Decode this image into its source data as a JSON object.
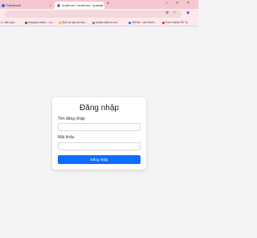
{
  "browser": {
    "tabs": [
      {
        "label": "Facebook",
        "favicon_color": "#1877f2"
      },
      {
        "label": "localhost / localhost / quanlyl",
        "favicon_color": "#6c78af"
      }
    ],
    "new_tab_symbol": "+",
    "window_controls": [
      "–",
      "□",
      "×"
    ],
    "tab_close_symbol": "×",
    "toolbar_icons": {
      "translate": "⊕",
      "star": "☆",
      "profile": "◉"
    },
    "bookmarks": [
      {
        "label": "c—Bài qua...",
        "color": "#999999"
      },
      {
        "label": "Notepad online - Le...",
        "color": "#2e7d32"
      },
      {
        "label": "Dịch vụ lấy mã bảo...",
        "color": "#f2c230"
      },
      {
        "label": "button-debt-in-ovi...",
        "color": "#888888"
      },
      {
        "label": "GitHub - devTranh...",
        "color": "#1877f2"
      },
      {
        "label": "Free Online PD To",
        "color": "#e53935"
      }
    ]
  },
  "login": {
    "title": "Đăng nhập",
    "username_label": "Tên đăng nhập",
    "username_value": "",
    "password_label": "Mật khẩu",
    "password_value": "",
    "submit_label": "Đăng nhập",
    "button_color": "#0d6efd"
  }
}
